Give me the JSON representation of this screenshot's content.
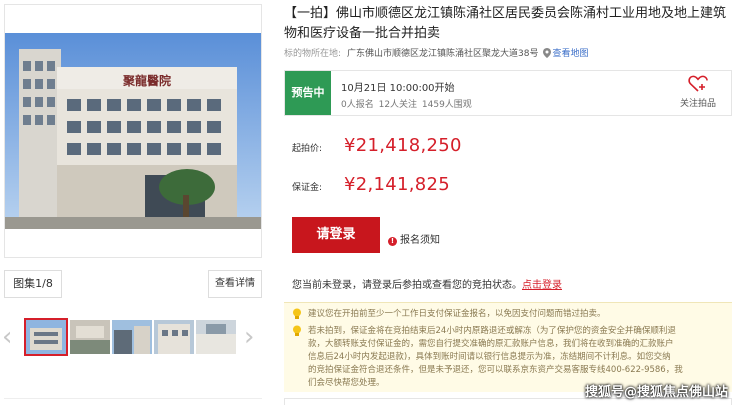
{
  "listing": {
    "title": "【一拍】佛山市顺德区龙江镇陈涌社区居民委员会陈涌村工业用地及地上建筑物和医疗设备一批合并拍卖",
    "location_label": "标的物所在地:",
    "location_address": "广东佛山市顺德区龙江镇陈涌社区聚龙大道38号",
    "map_link": "查看地图"
  },
  "gallery": {
    "counter": "图集1/8",
    "detail_button": "查看详情",
    "main_photo_sign": "聚龍醫院"
  },
  "status": {
    "tag": "预告中",
    "start_time": "10月21日 10:00:00开始",
    "stats": "0人报名 12人关注 1459人围观",
    "follow_label": "关注拍品"
  },
  "prices": {
    "start_label": "起拍价:",
    "start_value": "¥21,418,250",
    "deposit_label": "保证金:",
    "deposit_value": "¥2,141,825"
  },
  "actions": {
    "login_button": "请登录",
    "notice_link": "报名须知",
    "login_tip_text": "您当前未登录，请登录后参拍或查看您的竞拍状态。",
    "login_tip_link": "点击登录"
  },
  "tips": {
    "tip1": "建议您在开拍前至少一个工作日支付保证金报名，以免因支付问题而错过拍卖。",
    "tip2_lines": [
      "若未拍到，保证金将在竞拍结束后24小时内原路退还或解冻（为了保护您的资金安全并确保顺利退",
      "款，大额转账支付保证金的，需您自行提交准确的原汇款账户信息，我们将在收到准确的汇款账户",
      "信息后24小时内发起退款)，具体到账时间请以银行信息提示为准，冻结期间不计利息。如您交纳",
      "的竞拍保证金符合退还条件，但是未予退还，您可以联系京东资产交易客服专线400-622-9586，我",
      "们会尽快帮您处理。"
    ]
  },
  "watermark": "搜狐号@搜狐焦点佛山站",
  "colors": {
    "accent_red": "#d51f2a",
    "status_green": "#2e9a55",
    "tip_background": "#fffbe6",
    "link_blue": "#3c6fc8"
  }
}
